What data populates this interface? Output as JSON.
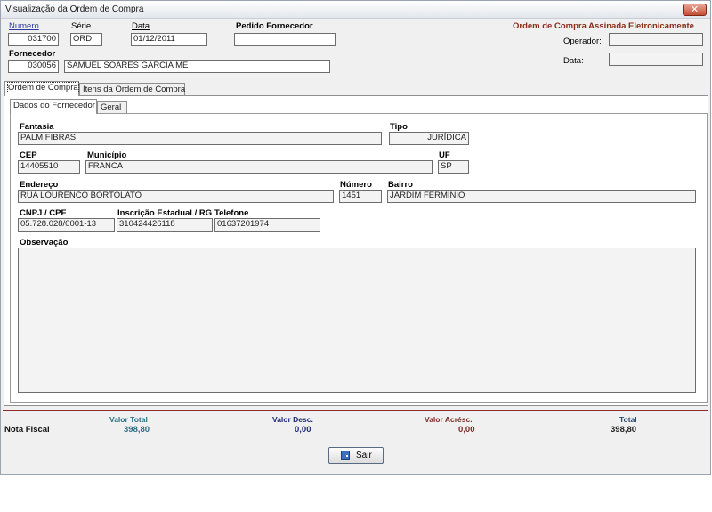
{
  "window": {
    "title": "Visualização da Ordem de Compra",
    "close_glyph": "✕"
  },
  "header": {
    "numero_label": "Numero",
    "numero_value": "031700",
    "serie_label": "Série",
    "serie_value": "ORD",
    "data_label": "Data",
    "data_value": "01/12/2011",
    "pedido_label": "Pedido Fornecedor",
    "pedido_value": "",
    "fornecedor_label": "Fornecedor",
    "fornecedor_code": "030056",
    "fornecedor_name": "SAMUEL SOARES GARCIA ME",
    "signed_label": "Ordem de Compra Assinada Eletronicamente",
    "operador_label": "Operador:",
    "operador_value": "",
    "data2_label": "Data:",
    "data2_value": ""
  },
  "tabs": [
    "Ordem de Compra",
    "Itens da Ordem de Compra"
  ],
  "subtabs": [
    "Dados do Fornecedor",
    "Geral"
  ],
  "supplier": {
    "fantasia_label": "Fantasia",
    "fantasia_value": "PALM FIBRAS",
    "tipo_label": "Tipo",
    "tipo_value": "JURÍDICA",
    "cep_label": "CEP",
    "cep_value": "14405510",
    "municipio_label": "Município",
    "municipio_value": "FRANCA",
    "uf_label": "UF",
    "uf_value": "SP",
    "endereco_label": "Endereço",
    "endereco_value": "RUA LOURENCO BORTOLATO",
    "numero_label": "Número",
    "numero_value": "1451",
    "bairro_label": "Bairro",
    "bairro_value": "JARDIM FERMINIO",
    "cnpj_label": "CNPJ / CPF",
    "cnpj_value": "05.728.028/0001-13",
    "ie_label": "Inscrição Estadual / RG",
    "ie_value": "310424426118",
    "telefone_label": "Telefone",
    "telefone_value": "01637201974",
    "observacao_label": "Observação",
    "observacao_value": ""
  },
  "totals": {
    "row_label": "Nota Fiscal",
    "valor_total_label": "Valor Total",
    "valor_total_value": "398,80",
    "valor_desc_label": "Valor Desc.",
    "valor_desc_value": "0,00",
    "valor_acresc_label": "Valor Acrésc.",
    "valor_acresc_value": "0,00",
    "total_label": "Total",
    "total_value": "398,80",
    "colors": {
      "teal": "#2a6f86",
      "navy": "#1e2a78",
      "maroon": "#7a2a22",
      "dark": "#222222"
    }
  },
  "footer": {
    "sair_label": "Sair",
    "sair_icon": "exit-door-icon"
  }
}
